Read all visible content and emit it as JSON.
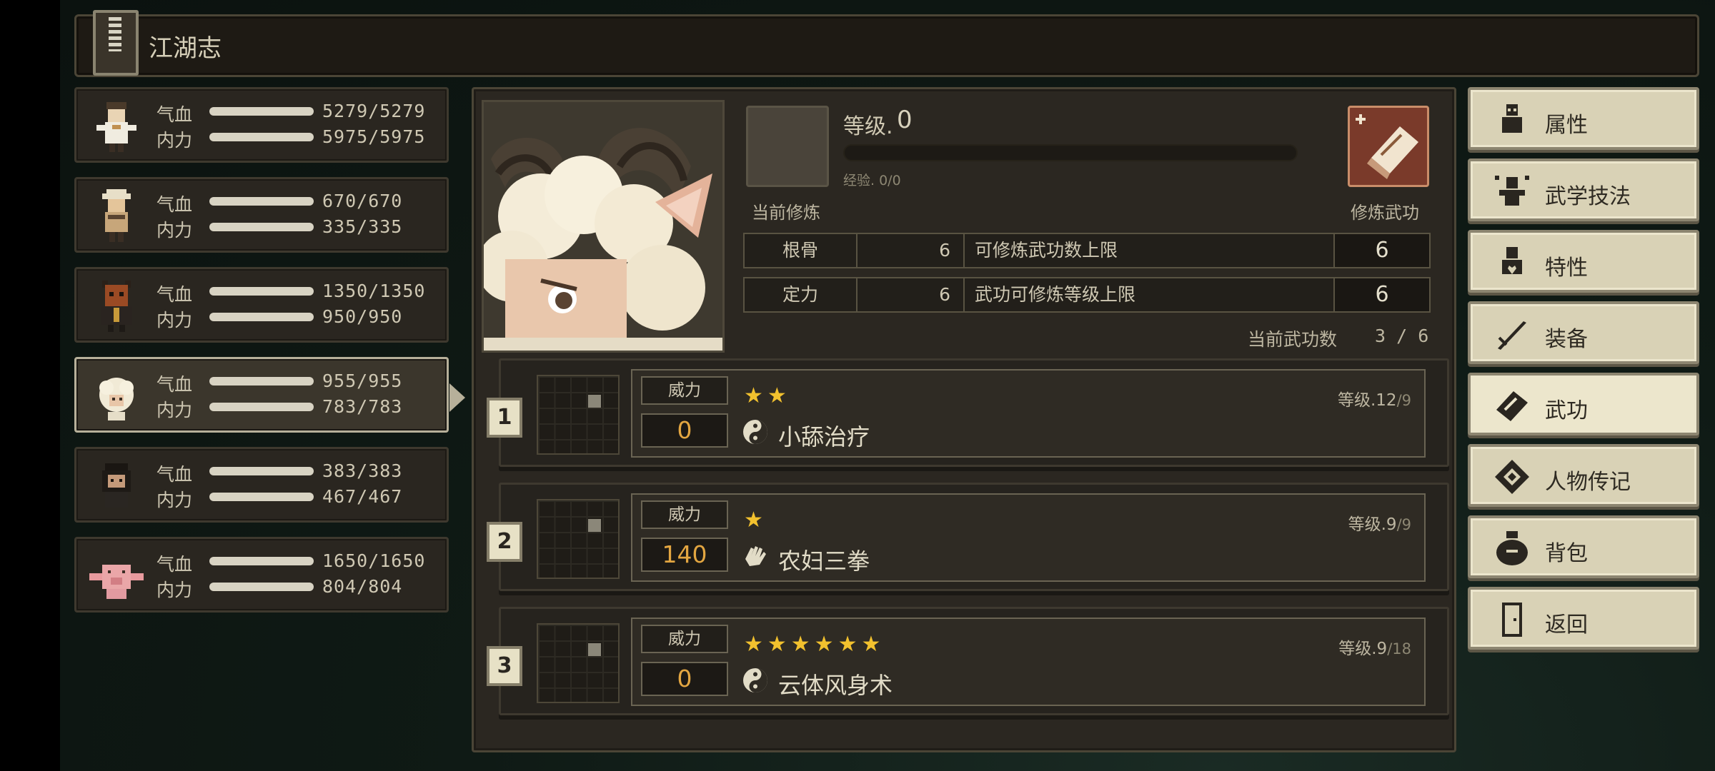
{
  "header": {
    "title": "江湖志"
  },
  "party": [
    {
      "hp_label": "气血",
      "hp": "5279/5279",
      "mp_label": "内力",
      "mp": "5975/5975",
      "avatar": "white-robed-hero",
      "selected": false
    },
    {
      "hp_label": "气血",
      "hp": "670/670",
      "mp_label": "内力",
      "mp": "335/335",
      "avatar": "hat-wearing-companion",
      "selected": false
    },
    {
      "hp_label": "气血",
      "hp": "1350/1350",
      "mp_label": "内力",
      "mp": "950/950",
      "avatar": "bull-beast-companion",
      "selected": false
    },
    {
      "hp_label": "气血",
      "hp": "955/955",
      "mp_label": "内力",
      "mp": "783/783",
      "avatar": "sheep-companion",
      "selected": true
    },
    {
      "hp_label": "气血",
      "hp": "383/383",
      "mp_label": "内力",
      "mp": "467/467",
      "avatar": "dark-haired-companion",
      "selected": false
    },
    {
      "hp_label": "气血",
      "hp": "1650/1650",
      "mp_label": "内力",
      "mp": "804/804",
      "avatar": "pig-companion",
      "selected": false
    }
  ],
  "detail": {
    "current_training_label": "当前修炼",
    "level_label": "等级.",
    "level_value": "0",
    "exp_label": "经验. 0/0",
    "train_button_label": "修炼武功",
    "attributes": [
      {
        "name": "根骨",
        "value": "6",
        "desc": "可修炼武功数上限",
        "cap": "6"
      },
      {
        "name": "定力",
        "value": "6",
        "desc": "武功可修炼等级上限",
        "cap": "6"
      }
    ],
    "skill_count_label": "当前武功数",
    "skill_count_value": "3 / 6"
  },
  "skills": [
    {
      "index": "1",
      "power_label": "威力",
      "power": "0",
      "stars": "★★",
      "star_count": 2,
      "type": "yin-yang",
      "name": "小舔治疗",
      "level_prefix": "等级.12",
      "level_max": "/9"
    },
    {
      "index": "2",
      "power_label": "威力",
      "power": "140",
      "stars": "★",
      "star_count": 1,
      "type": "palm",
      "name": "农妇三拳",
      "level_prefix": "等级.9",
      "level_max": "/9"
    },
    {
      "index": "3",
      "power_label": "威力",
      "power": "0",
      "stars": "★★★★★★",
      "star_count": 6,
      "type": "yin-yang",
      "name": "云体风身术",
      "level_prefix": "等级.9",
      "level_max": "/18"
    }
  ],
  "menu": [
    {
      "label": "属性",
      "icon": "person-icon",
      "active": false
    },
    {
      "label": "武学技法",
      "icon": "fighter-icon",
      "active": false
    },
    {
      "label": "特性",
      "icon": "heart-person-icon",
      "active": false
    },
    {
      "label": "装备",
      "icon": "sword-icon",
      "active": false
    },
    {
      "label": "武功",
      "icon": "scroll-book-icon",
      "active": true
    },
    {
      "label": "人物传记",
      "icon": "chain-icon",
      "active": false
    },
    {
      "label": "背包",
      "icon": "bag-icon",
      "active": false
    },
    {
      "label": "返回",
      "icon": "door-icon",
      "active": false
    }
  ],
  "colors": {
    "accent_gold": "#e3a641",
    "star": "#f2c12e",
    "menu_bg": "#d9d2b6",
    "panel_bg": "#2b2721"
  }
}
